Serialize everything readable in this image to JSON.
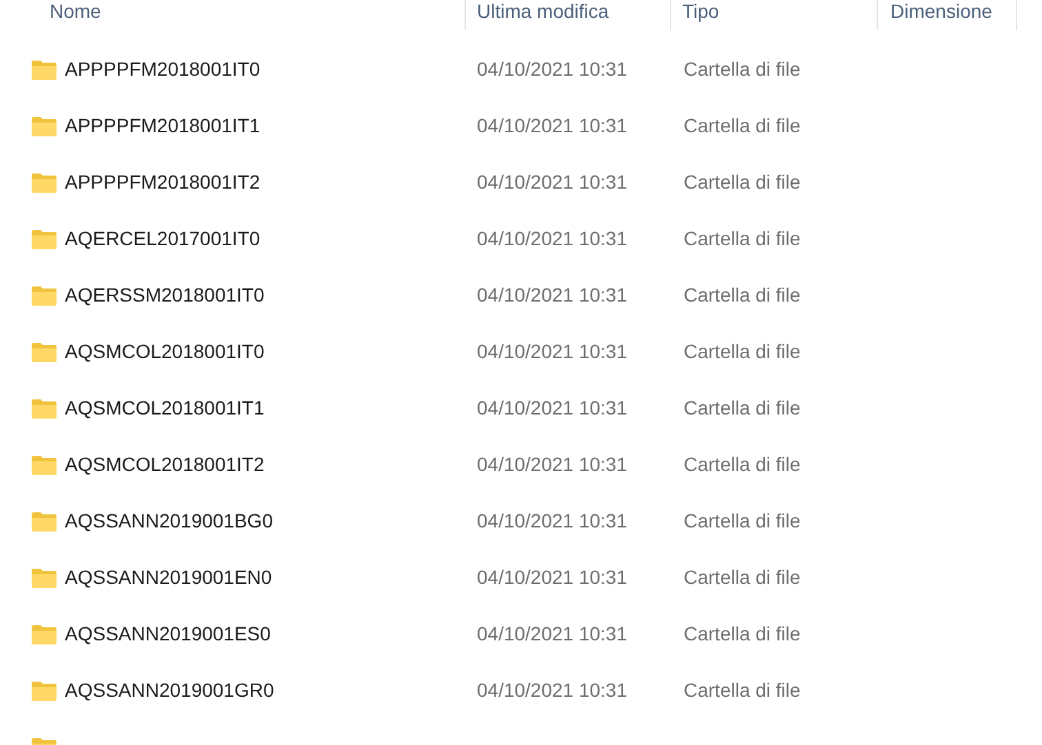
{
  "columns": [
    "Nome",
    "Ultima modifica",
    "Tipo",
    "Dimensione"
  ],
  "rows": [
    {
      "name": "APPPPFM2018001IT0",
      "modified": "04/10/2021 10:31",
      "type": "Cartella di file"
    },
    {
      "name": "APPPPFM2018001IT1",
      "modified": "04/10/2021 10:31",
      "type": "Cartella di file"
    },
    {
      "name": "APPPPFM2018001IT2",
      "modified": "04/10/2021 10:31",
      "type": "Cartella di file"
    },
    {
      "name": "AQERCEL2017001IT0",
      "modified": "04/10/2021 10:31",
      "type": "Cartella di file"
    },
    {
      "name": "AQERSSM2018001IT0",
      "modified": "04/10/2021 10:31",
      "type": "Cartella di file"
    },
    {
      "name": "AQSMCOL2018001IT0",
      "modified": "04/10/2021 10:31",
      "type": "Cartella di file"
    },
    {
      "name": "AQSMCOL2018001IT1",
      "modified": "04/10/2021 10:31",
      "type": "Cartella di file"
    },
    {
      "name": "AQSMCOL2018001IT2",
      "modified": "04/10/2021 10:31",
      "type": "Cartella di file"
    },
    {
      "name": "AQSSANN2019001BG0",
      "modified": "04/10/2021 10:31",
      "type": "Cartella di file"
    },
    {
      "name": "AQSSANN2019001EN0",
      "modified": "04/10/2021 10:31",
      "type": "Cartella di file"
    },
    {
      "name": "AQSSANN2019001ES0",
      "modified": "04/10/2021 10:31",
      "type": "Cartella di file"
    },
    {
      "name": "AQSSANN2019001GR0",
      "modified": "04/10/2021 10:31",
      "type": "Cartella di file"
    }
  ]
}
